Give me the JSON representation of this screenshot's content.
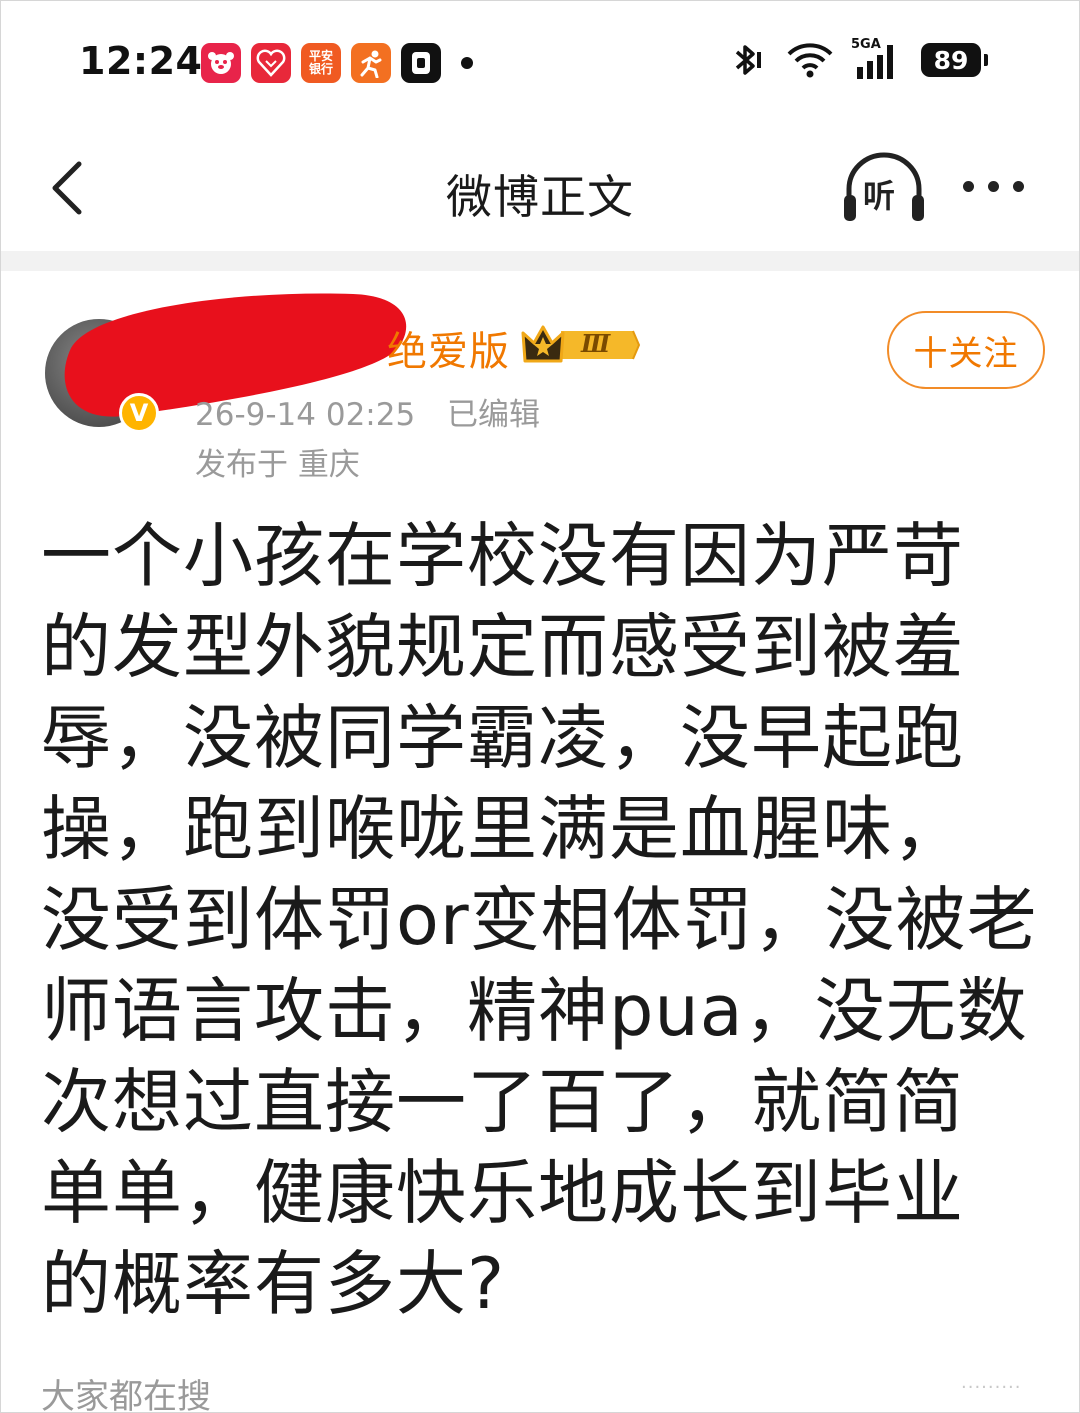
{
  "status_bar": {
    "time": "12:24",
    "notification_apps": [
      {
        "icon": "jd-app-icon",
        "label": "",
        "color": "#e8244a"
      },
      {
        "icon": "heart-app-icon",
        "label": "",
        "color": "#e8283a"
      },
      {
        "icon": "pingan-bank-icon",
        "label": "平安\n银行",
        "color": "#f05a22"
      },
      {
        "icon": "runner-app-icon",
        "label": "",
        "color": "#f37021"
      },
      {
        "icon": "wallet-app-icon",
        "label": "",
        "color": "#111111"
      }
    ],
    "network": "5GA",
    "battery": "89"
  },
  "nav": {
    "title": "微博正文",
    "listen_label": "听"
  },
  "post": {
    "author": {
      "name_visible": "绝爱版",
      "level_badge": "Ⅲ",
      "verified_mark": "V"
    },
    "time": "26-9-14 02:25",
    "edited": "已编辑",
    "location": "发布于 重庆",
    "follow_label": "十关注",
    "content_lines": [
      "一个小孩在学校没有因为严苛",
      "的发型外貌规定而感受到被羞",
      "辱，没被同学霸凌，没早起跑",
      "操，跑到喉咙里满是血腥味，",
      "没受到体罚or变相体罚，没被老",
      "师语言攻击，精神pua，没无数",
      "次想过直接一了百了，就简简",
      "单单，健康快乐地成长到毕业",
      "的概率有多大?"
    ]
  },
  "trending_label": "大家都在搜",
  "colors": {
    "accent": "#f07800",
    "muted_text": "#9a9a9a",
    "redaction": "#e8101c"
  }
}
